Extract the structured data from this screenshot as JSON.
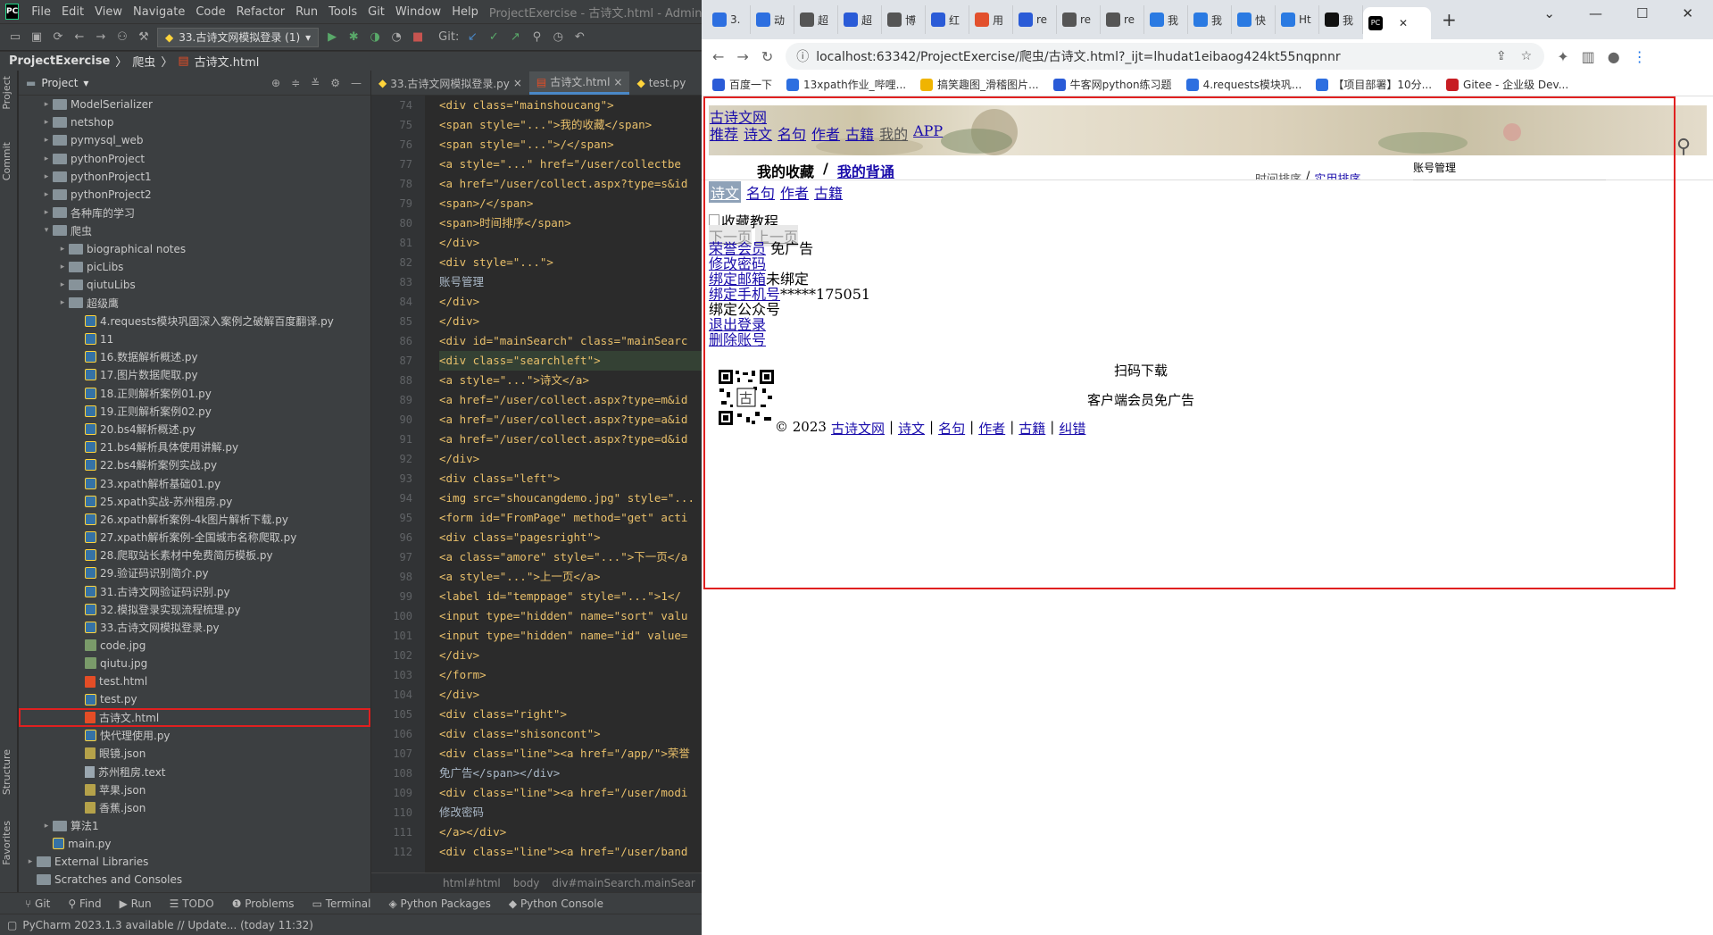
{
  "ide": {
    "logo": "PC",
    "menu": [
      "File",
      "Edit",
      "View",
      "Navigate",
      "Code",
      "Refactor",
      "Run",
      "Tools",
      "Git",
      "Window",
      "Help"
    ],
    "title": "ProjectExercise - 古诗文.html - Administrator",
    "run_config": "33.古诗文网模拟登录 (1)",
    "git_label": "Git:",
    "breadcrumb": [
      "ProjectExercise",
      "爬虫",
      "古诗文.html"
    ],
    "project_label": "Project",
    "side_labels": {
      "project": "Project",
      "commit": "Commit",
      "structure": "Structure",
      "favorites": "Favorites"
    },
    "tree": [
      {
        "label": "ModelSerializer",
        "type": "folder",
        "level": 1,
        "arrow": "▸"
      },
      {
        "label": "netshop",
        "type": "folder",
        "level": 1,
        "arrow": "▸"
      },
      {
        "label": "pymysql_web",
        "type": "folder",
        "level": 1,
        "arrow": "▸"
      },
      {
        "label": "pythonProject",
        "type": "folder",
        "level": 1,
        "arrow": "▸"
      },
      {
        "label": "pythonProject1",
        "type": "folder",
        "level": 1,
        "arrow": "▸"
      },
      {
        "label": "pythonProject2",
        "type": "folder",
        "level": 1,
        "arrow": "▸"
      },
      {
        "label": "各种库的学习",
        "type": "folder",
        "level": 1,
        "arrow": "▸"
      },
      {
        "label": "爬虫",
        "type": "folder",
        "level": 1,
        "arrow": "▾"
      },
      {
        "label": "biographical notes",
        "type": "folder",
        "level": 2,
        "arrow": "▸"
      },
      {
        "label": "picLibs",
        "type": "folder",
        "level": 2,
        "arrow": "▸"
      },
      {
        "label": "qiutuLibs",
        "type": "folder",
        "level": 2,
        "arrow": "▸"
      },
      {
        "label": "超级鹰",
        "type": "folder",
        "level": 2,
        "arrow": "▸"
      },
      {
        "label": "4.requests模块巩固深入案例之破解百度翻译.py",
        "type": "py",
        "level": 3,
        "arrow": ""
      },
      {
        "label": "11",
        "type": "py",
        "level": 3,
        "arrow": ""
      },
      {
        "label": "16.数据解析概述.py",
        "type": "py",
        "level": 3,
        "arrow": ""
      },
      {
        "label": "17.图片数据爬取.py",
        "type": "py",
        "level": 3,
        "arrow": ""
      },
      {
        "label": "18.正则解析案例01.py",
        "type": "py",
        "level": 3,
        "arrow": ""
      },
      {
        "label": "19.正则解析案例02.py",
        "type": "py",
        "level": 3,
        "arrow": ""
      },
      {
        "label": "20.bs4解析概述.py",
        "type": "py",
        "level": 3,
        "arrow": ""
      },
      {
        "label": "21.bs4解析具体使用讲解.py",
        "type": "py",
        "level": 3,
        "arrow": ""
      },
      {
        "label": "22.bs4解析案例实战.py",
        "type": "py",
        "level": 3,
        "arrow": ""
      },
      {
        "label": "23.xpath解析基础01.py",
        "type": "py",
        "level": 3,
        "arrow": ""
      },
      {
        "label": "25.xpath实战-苏州租房.py",
        "type": "py",
        "level": 3,
        "arrow": ""
      },
      {
        "label": "26.xpath解析案例-4k图片解析下载.py",
        "type": "py",
        "level": 3,
        "arrow": ""
      },
      {
        "label": "27.xpath解析案例-全国城市名称爬取.py",
        "type": "py",
        "level": 3,
        "arrow": ""
      },
      {
        "label": "28.爬取站长素材中免费简历模板.py",
        "type": "py",
        "level": 3,
        "arrow": ""
      },
      {
        "label": "29.验证码识别简介.py",
        "type": "py",
        "level": 3,
        "arrow": ""
      },
      {
        "label": "31.古诗文网验证码识别.py",
        "type": "py",
        "level": 3,
        "arrow": ""
      },
      {
        "label": "32.模拟登录实现流程梳理.py",
        "type": "py",
        "level": 3,
        "arrow": ""
      },
      {
        "label": "33.古诗文网模拟登录.py",
        "type": "py",
        "level": 3,
        "arrow": ""
      },
      {
        "label": "code.jpg",
        "type": "img",
        "level": 3,
        "arrow": ""
      },
      {
        "label": "qiutu.jpg",
        "type": "img",
        "level": 3,
        "arrow": ""
      },
      {
        "label": "test.html",
        "type": "html",
        "level": 3,
        "arrow": ""
      },
      {
        "label": "test.py",
        "type": "py",
        "level": 3,
        "arrow": ""
      },
      {
        "label": "古诗文.html",
        "type": "html",
        "level": 3,
        "arrow": "",
        "selected": true
      },
      {
        "label": "快代理使用.py",
        "type": "py",
        "level": 3,
        "arrow": ""
      },
      {
        "label": "眼镜.json",
        "type": "json",
        "level": 3,
        "arrow": ""
      },
      {
        "label": "苏州租房.text",
        "type": "file",
        "level": 3,
        "arrow": ""
      },
      {
        "label": "苹果.json",
        "type": "json",
        "level": 3,
        "arrow": ""
      },
      {
        "label": "香蕉.json",
        "type": "json",
        "level": 3,
        "arrow": ""
      },
      {
        "label": "算法1",
        "type": "folder",
        "level": 1,
        "arrow": "▸"
      },
      {
        "label": "main.py",
        "type": "py",
        "level": 1,
        "arrow": ""
      },
      {
        "label": "External Libraries",
        "type": "folder",
        "level": 0,
        "arrow": "▸"
      },
      {
        "label": "Scratches and Consoles",
        "type": "folder",
        "level": 0,
        "arrow": ""
      }
    ],
    "editor_tabs": [
      {
        "label": "33.古诗文网模拟登录.py",
        "active": false
      },
      {
        "label": "古诗文.html",
        "active": true
      },
      {
        "label": "test.py",
        "active": false
      }
    ],
    "line_numbers": [
      "74",
      "75",
      "76",
      "77",
      "78",
      "79",
      "80",
      "81",
      "82",
      "83",
      "84",
      "85",
      "86",
      "87",
      "88",
      "89",
      "90",
      "91",
      "92",
      "93",
      "94",
      "95",
      "96",
      "97",
      "98",
      "99",
      "100",
      "101",
      "102",
      "103",
      "104",
      "105",
      "106",
      "107",
      "108",
      "109",
      "110",
      "111",
      "112"
    ],
    "code_lines": [
      "<div class=\"mainshoucang\">",
      "<span style=\"...\">我的收藏</span>",
      "<span style=\"...\">/</span>",
      "<a style=\"...\" href=\"/user/collectbe",
      "<a href=\"/user/collect.aspx?type=s&id",
      "<span>/</span>",
      "<span>时间排序</span>",
      "</div>",
      "<div style=\"...\">",
      "账号管理",
      "</div>",
      "</div>",
      "<div id=\"mainSearch\" class=\"mainSearc",
      "<div class=\"searchleft\">",
      "<a style=\"...\">诗文</a>",
      "<a href=\"/user/collect.aspx?type=m&id",
      "<a href=\"/user/collect.aspx?type=a&id",
      "<a href=\"/user/collect.aspx?type=d&id",
      "</div>",
      "<div class=\"left\">",
      "<img src=\"shoucangdemo.jpg\" style=\"...",
      "<form id=\"FromPage\" method=\"get\" acti",
      "<div class=\"pagesright\">",
      "<a class=\"amore\" style=\"...\">下一页</a",
      "<a style=\"...\">上一页</a>",
      "<label id=\"temppage\" style=\"...\">1</",
      "<input type=\"hidden\" name=\"sort\" valu",
      "<input type=\"hidden\" name=\"id\" value=",
      "</div>",
      "</form>",
      "</div>",
      "<div class=\"right\">",
      "<div class=\"shisoncont\">",
      "<div class=\"line\"><a href=\"/app/\">荣誉",
      "免广告</span></div>",
      "<div class=\"line\"><a href=\"/user/modi",
      "修改密码",
      "</a></div>",
      "<div class=\"line\"><a href=\"/user/band"
    ],
    "editor_crumb": [
      "html#html",
      "body",
      "div#mainSearch.mainSear"
    ],
    "bottom_tools": [
      "Git",
      "Find",
      "Run",
      "TODO",
      "Problems",
      "Terminal",
      "Python Packages",
      "Python Console"
    ],
    "status": "PyCharm 2023.1.3 available // Update... (today 11:32)"
  },
  "browser": {
    "tabs": [
      {
        "label": "3.",
        "color": "#2d6fe0"
      },
      {
        "label": "动",
        "color": "#2d6fe0"
      },
      {
        "label": "超",
        "color": "#555"
      },
      {
        "label": "超",
        "color": "#2a5bd7"
      },
      {
        "label": "博",
        "color": "#555"
      },
      {
        "label": "红",
        "color": "#2a5bd7"
      },
      {
        "label": "用",
        "color": "#e2502d"
      },
      {
        "label": "re",
        "color": "#2a5bd7"
      },
      {
        "label": "re",
        "color": "#555"
      },
      {
        "label": "re",
        "color": "#555"
      },
      {
        "label": "我",
        "color": "#2a7ae2"
      },
      {
        "label": "我",
        "color": "#2a7ae2"
      },
      {
        "label": "快",
        "color": "#2a7ae2"
      },
      {
        "label": "Ht",
        "color": "#2a7ae2"
      },
      {
        "label": "我",
        "color": "#111"
      }
    ],
    "active_tab_icon": "PC",
    "url": "localhost:63342/ProjectExercise/爬虫/古诗文.html?_ijt=lhudat1eibaog424kt55nqpnnr",
    "bookmarks": [
      {
        "label": "百度一下",
        "color": "#2a5bd7"
      },
      {
        "label": "13xpath作业_哔哩...",
        "color": "#2d6fe0"
      },
      {
        "label": "搞笑趣图_滑稽图片...",
        "color": "#f0b400"
      },
      {
        "label": "牛客网python练习题",
        "color": "#2a5bd7"
      },
      {
        "label": "4.requests模块巩...",
        "color": "#2d6fe0"
      },
      {
        "label": "【项目部署】10分...",
        "color": "#2d6fe0"
      },
      {
        "label": "Gitee - 企业级 Dev...",
        "color": "#c71d23"
      }
    ],
    "page": {
      "site_name": "古诗文网",
      "nav": [
        "推荐",
        "诗文",
        "名句",
        "作者",
        "古籍",
        "我的",
        "APP"
      ],
      "collect_title": "我的收藏",
      "slash": "/",
      "recite_link": "我的背诵",
      "sort_time": "时间排序",
      "sort_sep": "/",
      "sort_author": "实用排序",
      "account": "账号管理",
      "filters": [
        "诗文",
        "名句",
        "作者",
        "古籍"
      ],
      "img_alt": "收藏教程",
      "next_page": "下一页",
      "prev_page": "上一页",
      "vip_link": "荣誉会员",
      "vip_text": " 免广告",
      "change_pwd": "修改密码",
      "bind_email": "绑定邮箱",
      "email_status": "未绑定",
      "bind_phone": "绑定手机号",
      "phone_value": "*****175051",
      "bind_wechat": "绑定公众号",
      "logout": "退出登录",
      "delete_account": "删除账号",
      "qr_char": "古",
      "scan_download": "扫码下载",
      "app_ad": "客户端会员免广告",
      "footer_copy": "© 2023",
      "footer_links": [
        "古诗文网",
        "诗文",
        "名句",
        "作者",
        "古籍",
        "纠错"
      ]
    }
  }
}
